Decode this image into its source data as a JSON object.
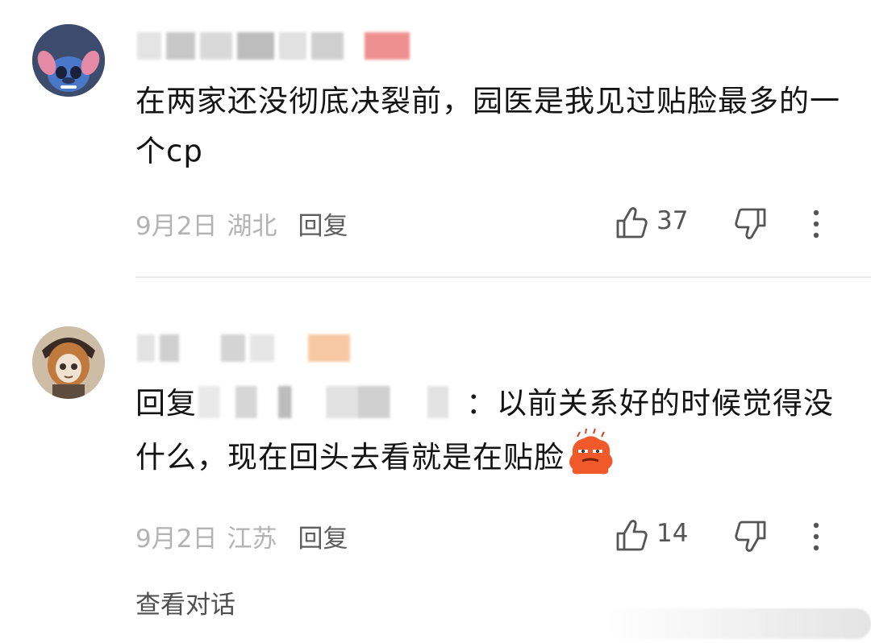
{
  "comments": [
    {
      "text": "在两家还没彻底决裂前，园医是我见过贴脸最多的一个cp",
      "date": "9月2日",
      "location": "湖北",
      "reply_label": "回复",
      "likes": "37"
    },
    {
      "reply_prefix": "回复",
      "text_after_mask": "：以前关系好的时候觉得没什么，现在回头去看就是在贴脸",
      "date": "9月2日",
      "location": "江苏",
      "reply_label": "回复",
      "likes": "14",
      "view_conversation": "查看对话"
    }
  ],
  "icons": {
    "like": "thumbs-up-icon",
    "dislike": "thumbs-down-icon",
    "more": "vertical-dots-icon",
    "emoji": "angry-red-emoji-icon"
  },
  "colors": {
    "text": "#141414",
    "meta": "#b3b3b3",
    "reply": "#5e5e5e"
  }
}
